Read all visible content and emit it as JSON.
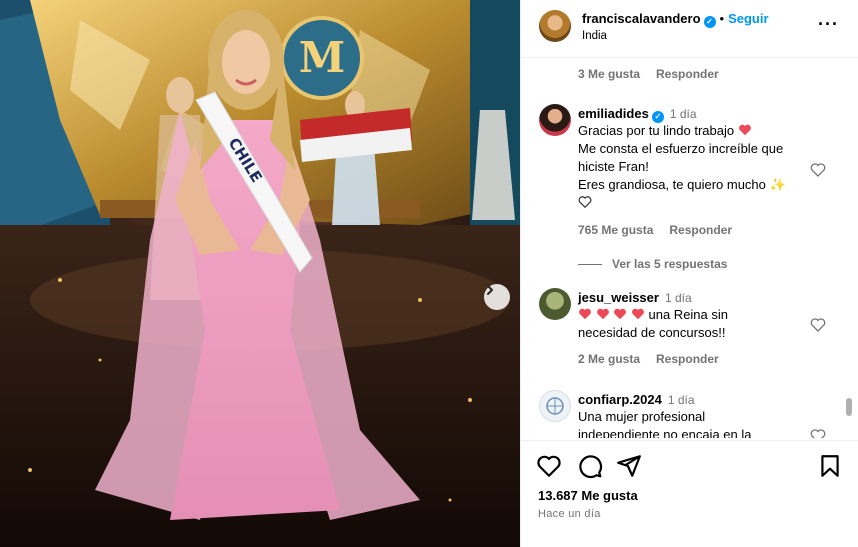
{
  "post": {
    "username": "franciscalavandero",
    "follow_label": "Seguir",
    "location": "India",
    "more_label": "···",
    "likes": "13.687 Me gusta",
    "time_ago": "Hace un día"
  },
  "image": {
    "sash_text": "CHILE"
  },
  "comments": [
    {
      "meta_likes": "3 Me gusta",
      "meta_reply": "Responder"
    },
    {
      "username": "emiliadides",
      "verified": true,
      "time": "1 día",
      "lines": [
        "Gracias por tu lindo trabajo",
        "Me consta el esfuerzo increíble que",
        "hiciste Fran!",
        "Eres grandiosa, te quiero mucho"
      ],
      "meta_likes": "765 Me gusta",
      "meta_reply": "Responder",
      "view_replies": "Ver las 5 respuestas"
    },
    {
      "username": "jesu_weisser",
      "time": "1 día",
      "lines": [
        "una Reina sin",
        "necesidad de concursos!!"
      ],
      "meta_likes": "2 Me gusta",
      "meta_reply": "Responder"
    },
    {
      "username": "confiarp.2024",
      "time": "1 día",
      "lines": [
        "Una mujer profesional",
        "independiente no encaja en la"
      ]
    }
  ],
  "colors": {
    "accent": "#0095f6",
    "heart_red": "#ed4956",
    "muted": "#737373"
  },
  "icons": [
    "heart-icon",
    "comment-icon",
    "share-icon",
    "bookmark-icon",
    "chevron-right-icon",
    "verified-icon",
    "more-icon"
  ]
}
